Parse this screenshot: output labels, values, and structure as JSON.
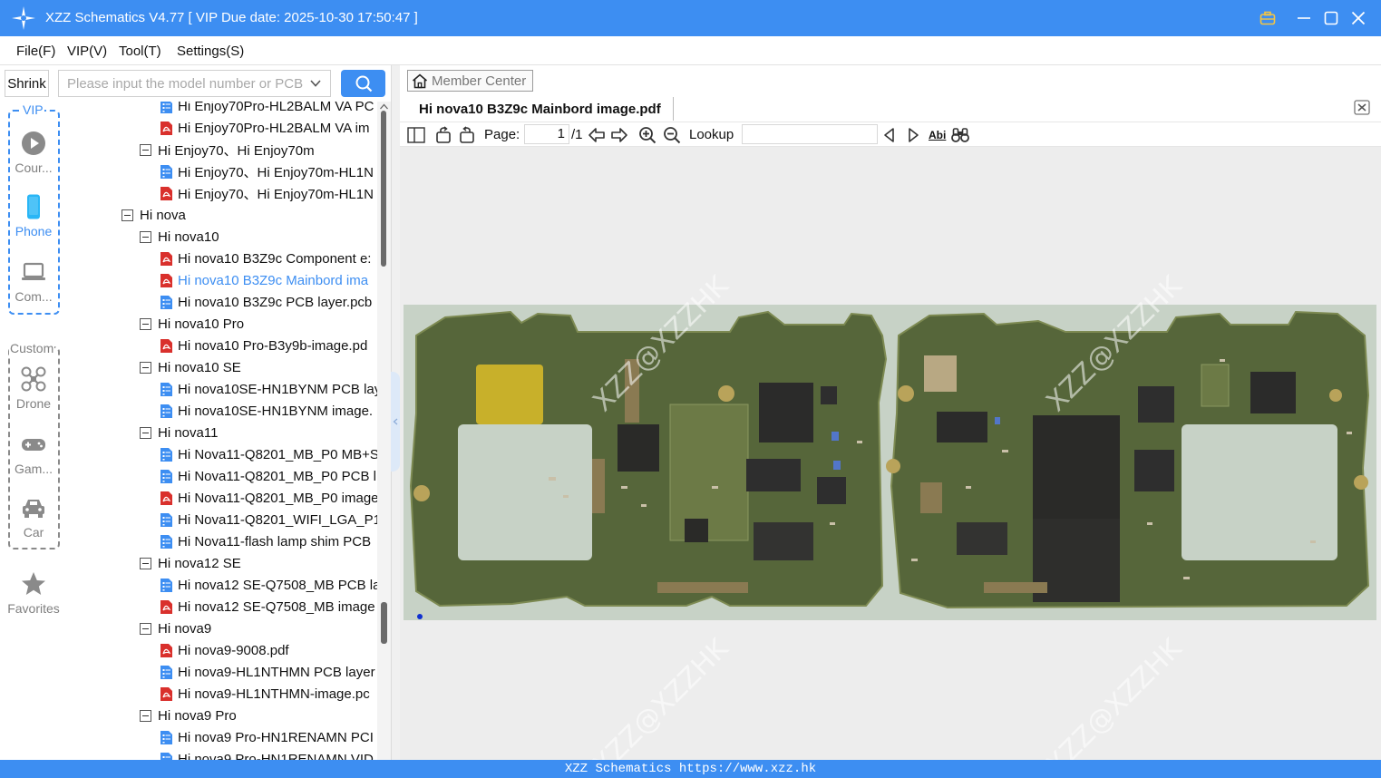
{
  "window": {
    "title": "XZZ Schematics V4.77 [ VIP Due date: 2025-10-30 17:50:47 ]"
  },
  "menu": [
    "File(F)",
    "VIP(V)",
    "Tool(T)",
    "Settings(S)"
  ],
  "search": {
    "shrink_label": "Shrink",
    "placeholder": "Please input the model number or PCB"
  },
  "categories": {
    "vip_group_label": "VIP",
    "custom_group_label": "Custom",
    "items": [
      {
        "label": "Cour...",
        "icon": "play-circle-icon",
        "active": false
      },
      {
        "label": "Phone",
        "icon": "phone-icon",
        "active": true
      },
      {
        "label": "Com...",
        "icon": "laptop-icon",
        "active": false
      },
      {
        "label": "Drone",
        "icon": "drone-icon",
        "active": false
      },
      {
        "label": "Gam...",
        "icon": "gamepad-icon",
        "active": false
      },
      {
        "label": "Car",
        "icon": "car-icon",
        "active": false
      },
      {
        "label": "Favorites",
        "icon": "star-icon",
        "active": false
      }
    ]
  },
  "tree": [
    {
      "level": 2,
      "type": "pcb",
      "label": "Hi Enjoy70Pro-HL2BALM VA PC"
    },
    {
      "level": 2,
      "type": "pdf",
      "label": "Hi Enjoy70Pro-HL2BALM VA im"
    },
    {
      "level": 1,
      "type": "folder",
      "label": "Hi Enjoy70、Hi Enjoy70m"
    },
    {
      "level": 2,
      "type": "pcb",
      "label": "Hi Enjoy70、Hi Enjoy70m-HL1N"
    },
    {
      "level": 2,
      "type": "pdf",
      "label": "Hi Enjoy70、Hi Enjoy70m-HL1N"
    },
    {
      "level": 0,
      "type": "folder",
      "label": "Hi nova"
    },
    {
      "level": 1,
      "type": "folder",
      "label": "Hi nova10"
    },
    {
      "level": 2,
      "type": "pdf",
      "label": "Hi nova10 B3Z9c Component e:"
    },
    {
      "level": 2,
      "type": "pdf",
      "label": "Hi nova10 B3Z9c Mainbord ima",
      "selected": true
    },
    {
      "level": 2,
      "type": "pcb",
      "label": "Hi nova10 B3Z9c PCB layer.pcb"
    },
    {
      "level": 1,
      "type": "folder",
      "label": "Hi nova10 Pro"
    },
    {
      "level": 2,
      "type": "pdf",
      "label": "Hi nova10 Pro-B3y9b-image.pd"
    },
    {
      "level": 1,
      "type": "folder",
      "label": "Hi nova10 SE"
    },
    {
      "level": 2,
      "type": "pcb",
      "label": "Hi nova10SE-HN1BYNM PCB lay"
    },
    {
      "level": 2,
      "type": "pcb",
      "label": "Hi nova10SE-HN1BYNM image."
    },
    {
      "level": 1,
      "type": "folder",
      "label": "Hi nova11"
    },
    {
      "level": 2,
      "type": "pcb",
      "label": "Hi Nova11-Q8201_MB_P0 MB+S"
    },
    {
      "level": 2,
      "type": "pcb",
      "label": "Hi Nova11-Q8201_MB_P0 PCB l"
    },
    {
      "level": 2,
      "type": "pdf",
      "label": "Hi Nova11-Q8201_MB_P0 image"
    },
    {
      "level": 2,
      "type": "pcb",
      "label": "Hi Nova11-Q8201_WIFI_LGA_P1"
    },
    {
      "level": 2,
      "type": "pcb",
      "label": "Hi Nova11-flash lamp shim PCB"
    },
    {
      "level": 1,
      "type": "folder",
      "label": "Hi nova12 SE"
    },
    {
      "level": 2,
      "type": "pcb",
      "label": "Hi nova12 SE-Q7508_MB PCB la"
    },
    {
      "level": 2,
      "type": "pdf",
      "label": "Hi nova12 SE-Q7508_MB image"
    },
    {
      "level": 1,
      "type": "folder",
      "label": "Hi nova9"
    },
    {
      "level": 2,
      "type": "pdf",
      "label": "Hi nova9-9008.pdf"
    },
    {
      "level": 2,
      "type": "pcb",
      "label": "Hi nova9-HL1NTHMN PCB layer"
    },
    {
      "level": 2,
      "type": "pdf",
      "label": "Hi nova9-HL1NTHMN-image.pc"
    },
    {
      "level": 1,
      "type": "folder",
      "label": "Hi nova9 Pro"
    },
    {
      "level": 2,
      "type": "pcb",
      "label": "Hi nova9 Pro-HN1RENAMN PCI"
    },
    {
      "level": 2,
      "type": "pcb",
      "label": "Hi nova9 Pro-HN1RENAMN VID"
    }
  ],
  "doc": {
    "member_center_label": "Member Center",
    "tab_title": "Hi nova10 B3Z9c Mainbord image.pdf",
    "toolbar": {
      "page_label": "Page:",
      "page_current": "1",
      "page_total": "/1",
      "lookup_label": "Lookup",
      "lookup_value": "",
      "abi_label": "Abi"
    },
    "watermark_text": "XZZ@XZZHK"
  },
  "status": {
    "text": "XZZ Schematics https://www.xzz.hk"
  },
  "colors": {
    "accent": "#3d8ef2",
    "pdf_red": "#d9302c",
    "pcb_blue": "#3d8ef2",
    "board_green": "#5a6b38"
  }
}
